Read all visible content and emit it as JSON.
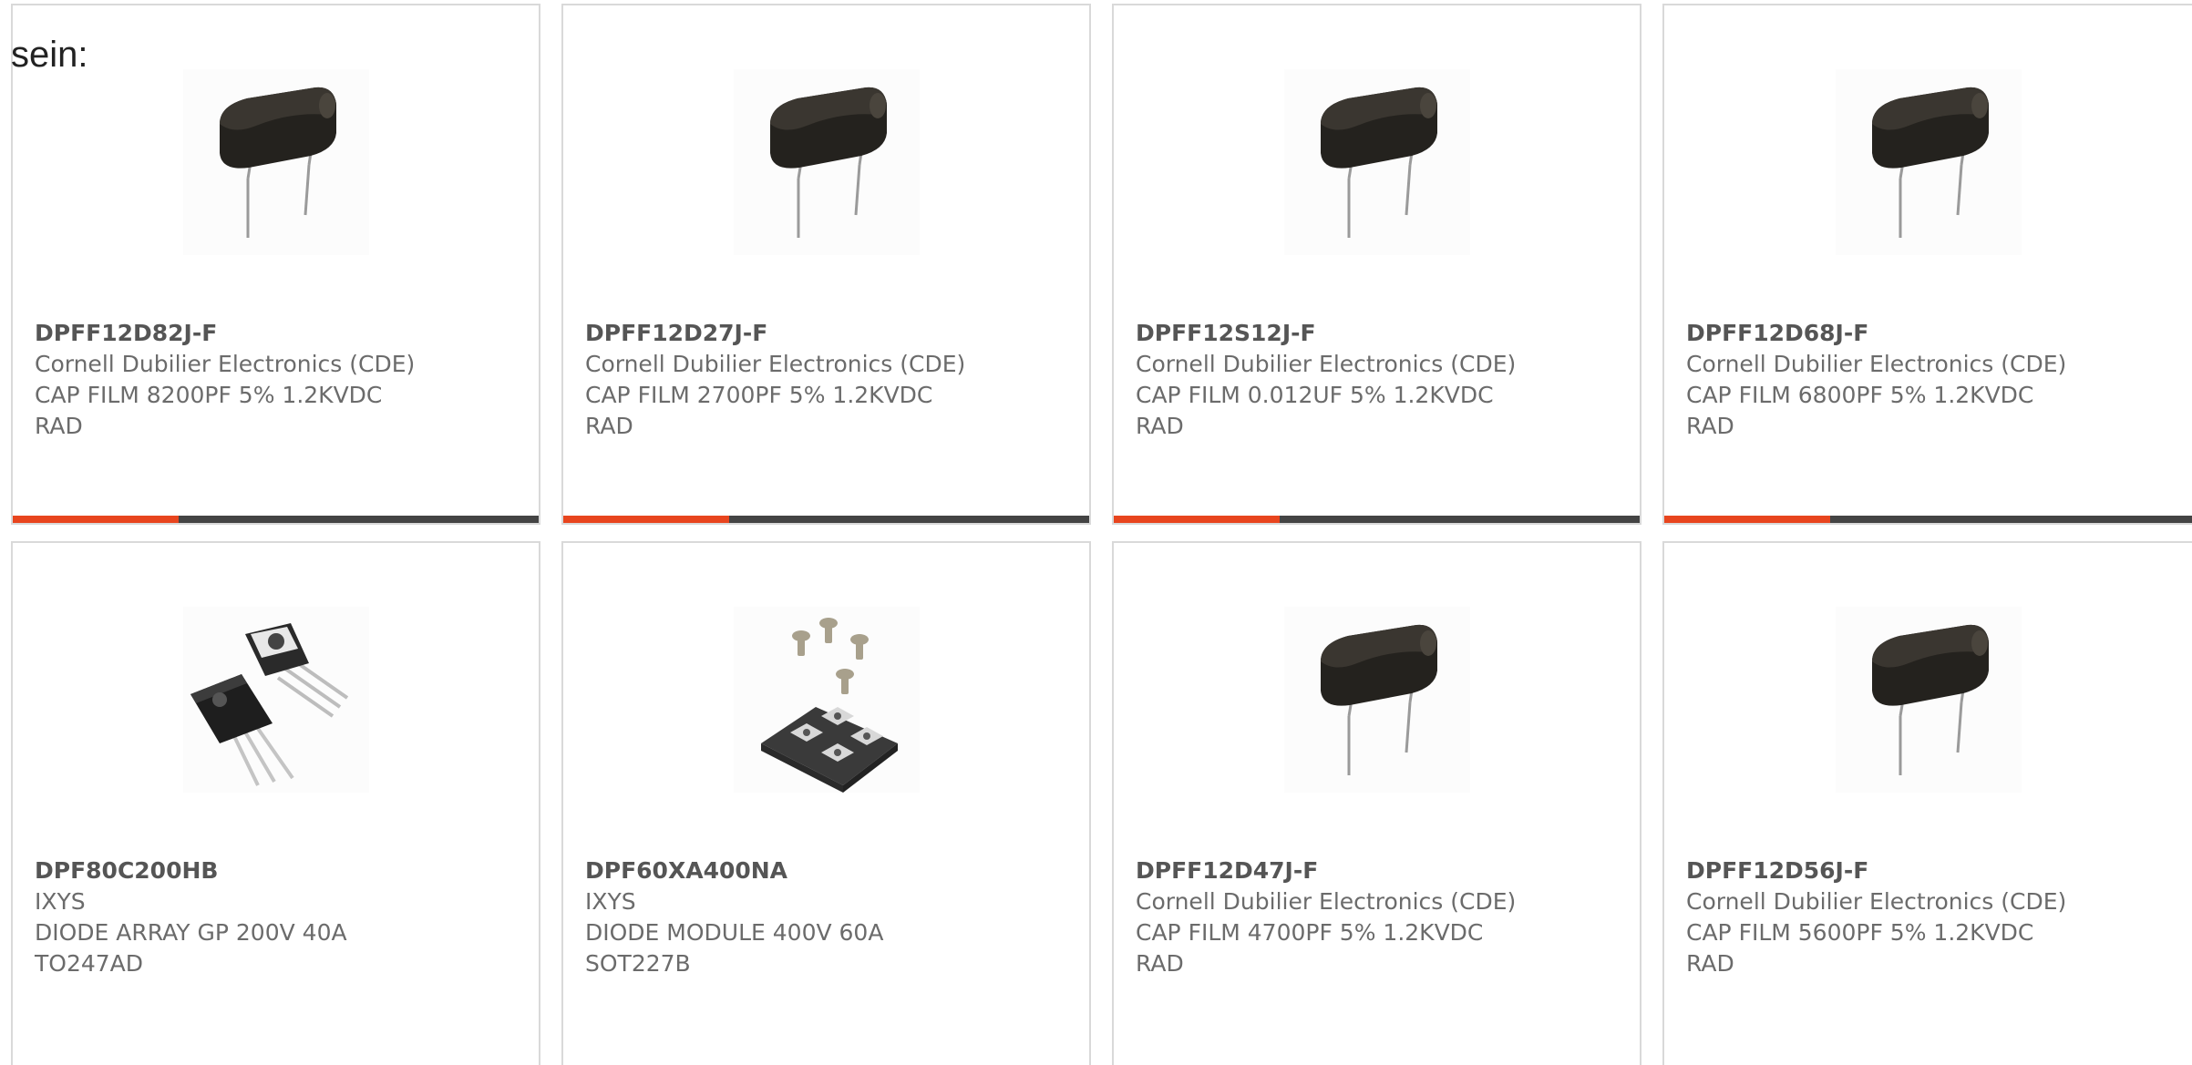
{
  "intro": {
    "text": "sein:"
  },
  "accent_color": "#e8451e",
  "bar_color": "#444444",
  "products": [
    {
      "part_number": "DPFF12D82J-F",
      "manufacturer": "Cornell Dubilier Electronics (CDE)",
      "description_line1": "CAP FILM 8200PF 5% 1.2KVDC",
      "description_line2": "RAD",
      "image": "film-capacitor-image"
    },
    {
      "part_number": "DPFF12D27J-F",
      "manufacturer": "Cornell Dubilier Electronics (CDE)",
      "description_line1": "CAP FILM 2700PF 5% 1.2KVDC",
      "description_line2": "RAD",
      "image": "film-capacitor-image"
    },
    {
      "part_number": "DPFF12S12J-F",
      "manufacturer": "Cornell Dubilier Electronics (CDE)",
      "description_line1": "CAP FILM 0.012UF 5% 1.2KVDC",
      "description_line2": "RAD",
      "image": "film-capacitor-image"
    },
    {
      "part_number": "DPFF12D68J-F",
      "manufacturer": "Cornell Dubilier Electronics (CDE)",
      "description_line1": "CAP FILM 6800PF 5% 1.2KVDC",
      "description_line2": "RAD",
      "image": "film-capacitor-image"
    },
    {
      "part_number": "DPF80C200HB",
      "manufacturer": "IXYS",
      "description_line1": "DIODE ARRAY GP 200V 40A",
      "description_line2": "TO247AD",
      "image": "to247-package-image"
    },
    {
      "part_number": "DPF60XA400NA",
      "manufacturer": "IXYS",
      "description_line1": "DIODE MODULE 400V 60A",
      "description_line2": "SOT227B",
      "image": "sot227-module-image"
    },
    {
      "part_number": "DPFF12D47J-F",
      "manufacturer": "Cornell Dubilier Electronics (CDE)",
      "description_line1": "CAP FILM 4700PF 5% 1.2KVDC",
      "description_line2": "RAD",
      "image": "film-capacitor-image"
    },
    {
      "part_number": "DPFF12D56J-F",
      "manufacturer": "Cornell Dubilier Electronics (CDE)",
      "description_line1": "CAP FILM 5600PF 5% 1.2KVDC",
      "description_line2": "RAD",
      "image": "film-capacitor-image"
    }
  ]
}
